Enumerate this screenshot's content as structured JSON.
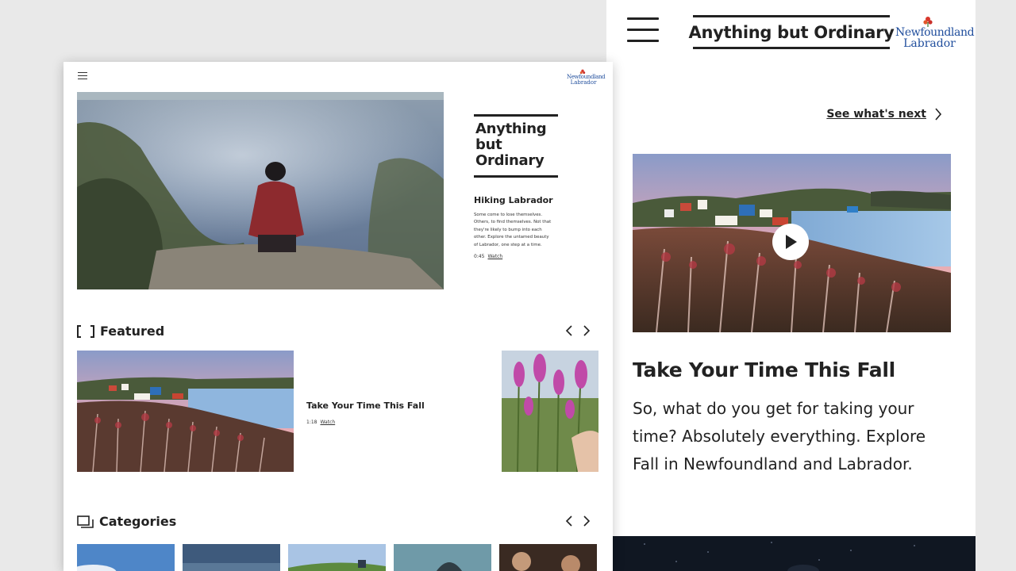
{
  "mobile": {
    "brand_title": "Anything but Ordinary",
    "logo_line1": "Newfoundland",
    "logo_line2": "Labrador",
    "next_link": "See what's next",
    "feature_title": "Take Your Time This Fall",
    "feature_desc": "So, what do you get for taking your time? Absolutely everything. Explore Fall in Newfoundland and Labrador."
  },
  "desktop": {
    "logo_line1": "Newfoundland",
    "logo_line2": "Labrador",
    "brand_line1": "Anything",
    "brand_line2": "but",
    "brand_line3": "Ordinary",
    "hero": {
      "title": "Hiking Labrador",
      "desc": "Some come to lose themselves. Others, to find themselves. Not that they're likely to bump into each other. Explore the untamed beauty of Labrador, one step at a time.",
      "duration": "0:45",
      "watch": "Watch"
    },
    "featured": {
      "heading": "Featured",
      "item_title": "Take Your Time This Fall",
      "item_duration": "1:18",
      "item_watch": "Watch"
    },
    "categories": {
      "heading": "Categories"
    }
  },
  "colors": {
    "brand_blue": "#1f4d9c",
    "accent_red": "#d8382c",
    "text": "#222222",
    "page_bg": "#e9e9e9"
  },
  "icons": [
    "menu-icon",
    "chevron-right-icon",
    "chevron-left-icon",
    "play-icon",
    "brackets-icon",
    "categories-icon",
    "logo-flower-icon"
  ]
}
